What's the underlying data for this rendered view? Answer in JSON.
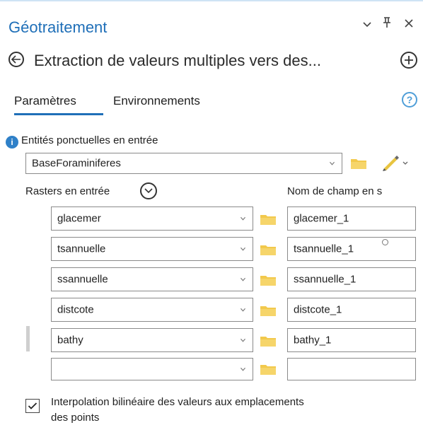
{
  "header": {
    "title": "Géotraitement",
    "tool_name": "Extraction de valeurs multiples vers des..."
  },
  "tabs": {
    "parameters": "Paramètres",
    "environments": "Environnements"
  },
  "input_points": {
    "label": "Entités ponctuelles en entrée",
    "value": "BaseForaminiferes"
  },
  "rasters": {
    "label": "Rasters en entrée",
    "field_name_header": "Nom de champ en s",
    "rows": [
      {
        "raster": "glacemer",
        "field": "glacemer_1"
      },
      {
        "raster": "tsannuelle",
        "field": "tsannuelle_1"
      },
      {
        "raster": "ssannuelle",
        "field": "ssannuelle_1"
      },
      {
        "raster": "distcote",
        "field": "distcote_1"
      },
      {
        "raster": "bathy",
        "field": "bathy_1"
      },
      {
        "raster": "",
        "field": ""
      }
    ]
  },
  "options": {
    "bilinear_checked": true,
    "bilinear_label_line1": "Interpolation bilinéaire des valeurs aux emplacements",
    "bilinear_label_line2": "des points"
  },
  "colors": {
    "accent": "#1f6fb8",
    "folder": "#f2c94c",
    "info": "#2f80c8"
  }
}
